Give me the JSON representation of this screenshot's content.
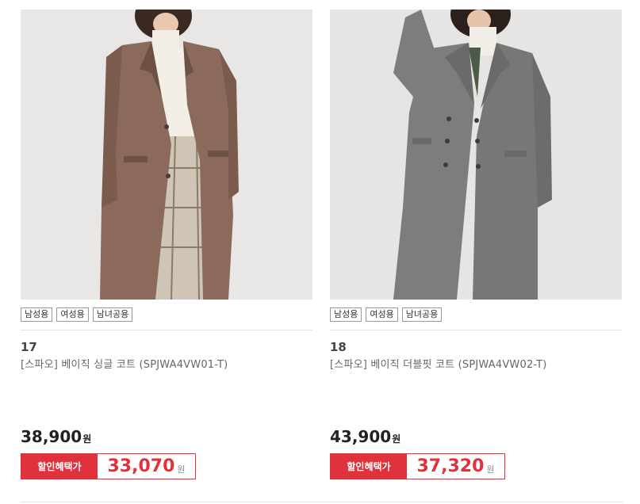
{
  "products": [
    {
      "number": "17",
      "name": "[스파오] 베이직 싱글 코트 (SPJWA4VW01-T)",
      "tags": [
        "남성용",
        "여성용",
        "남녀공용"
      ],
      "price": "38,900",
      "price_unit": "원",
      "sale_label": "할인혜택가",
      "sale_price": "33,070",
      "sale_unit": "원",
      "coat_color": "#8b6a5c"
    },
    {
      "number": "18",
      "name": "[스파오] 베이직 더블핏 코트 (SPJWA4VW02-T)",
      "tags": [
        "남성용",
        "여성용",
        "남녀공용"
      ],
      "price": "43,900",
      "price_unit": "원",
      "sale_label": "할인혜택가",
      "sale_price": "37,320",
      "sale_unit": "원",
      "coat_color": "#7d7d7b"
    }
  ],
  "colors": {
    "accent": "#e0323c",
    "photo_bg": "#e7e6e4"
  }
}
